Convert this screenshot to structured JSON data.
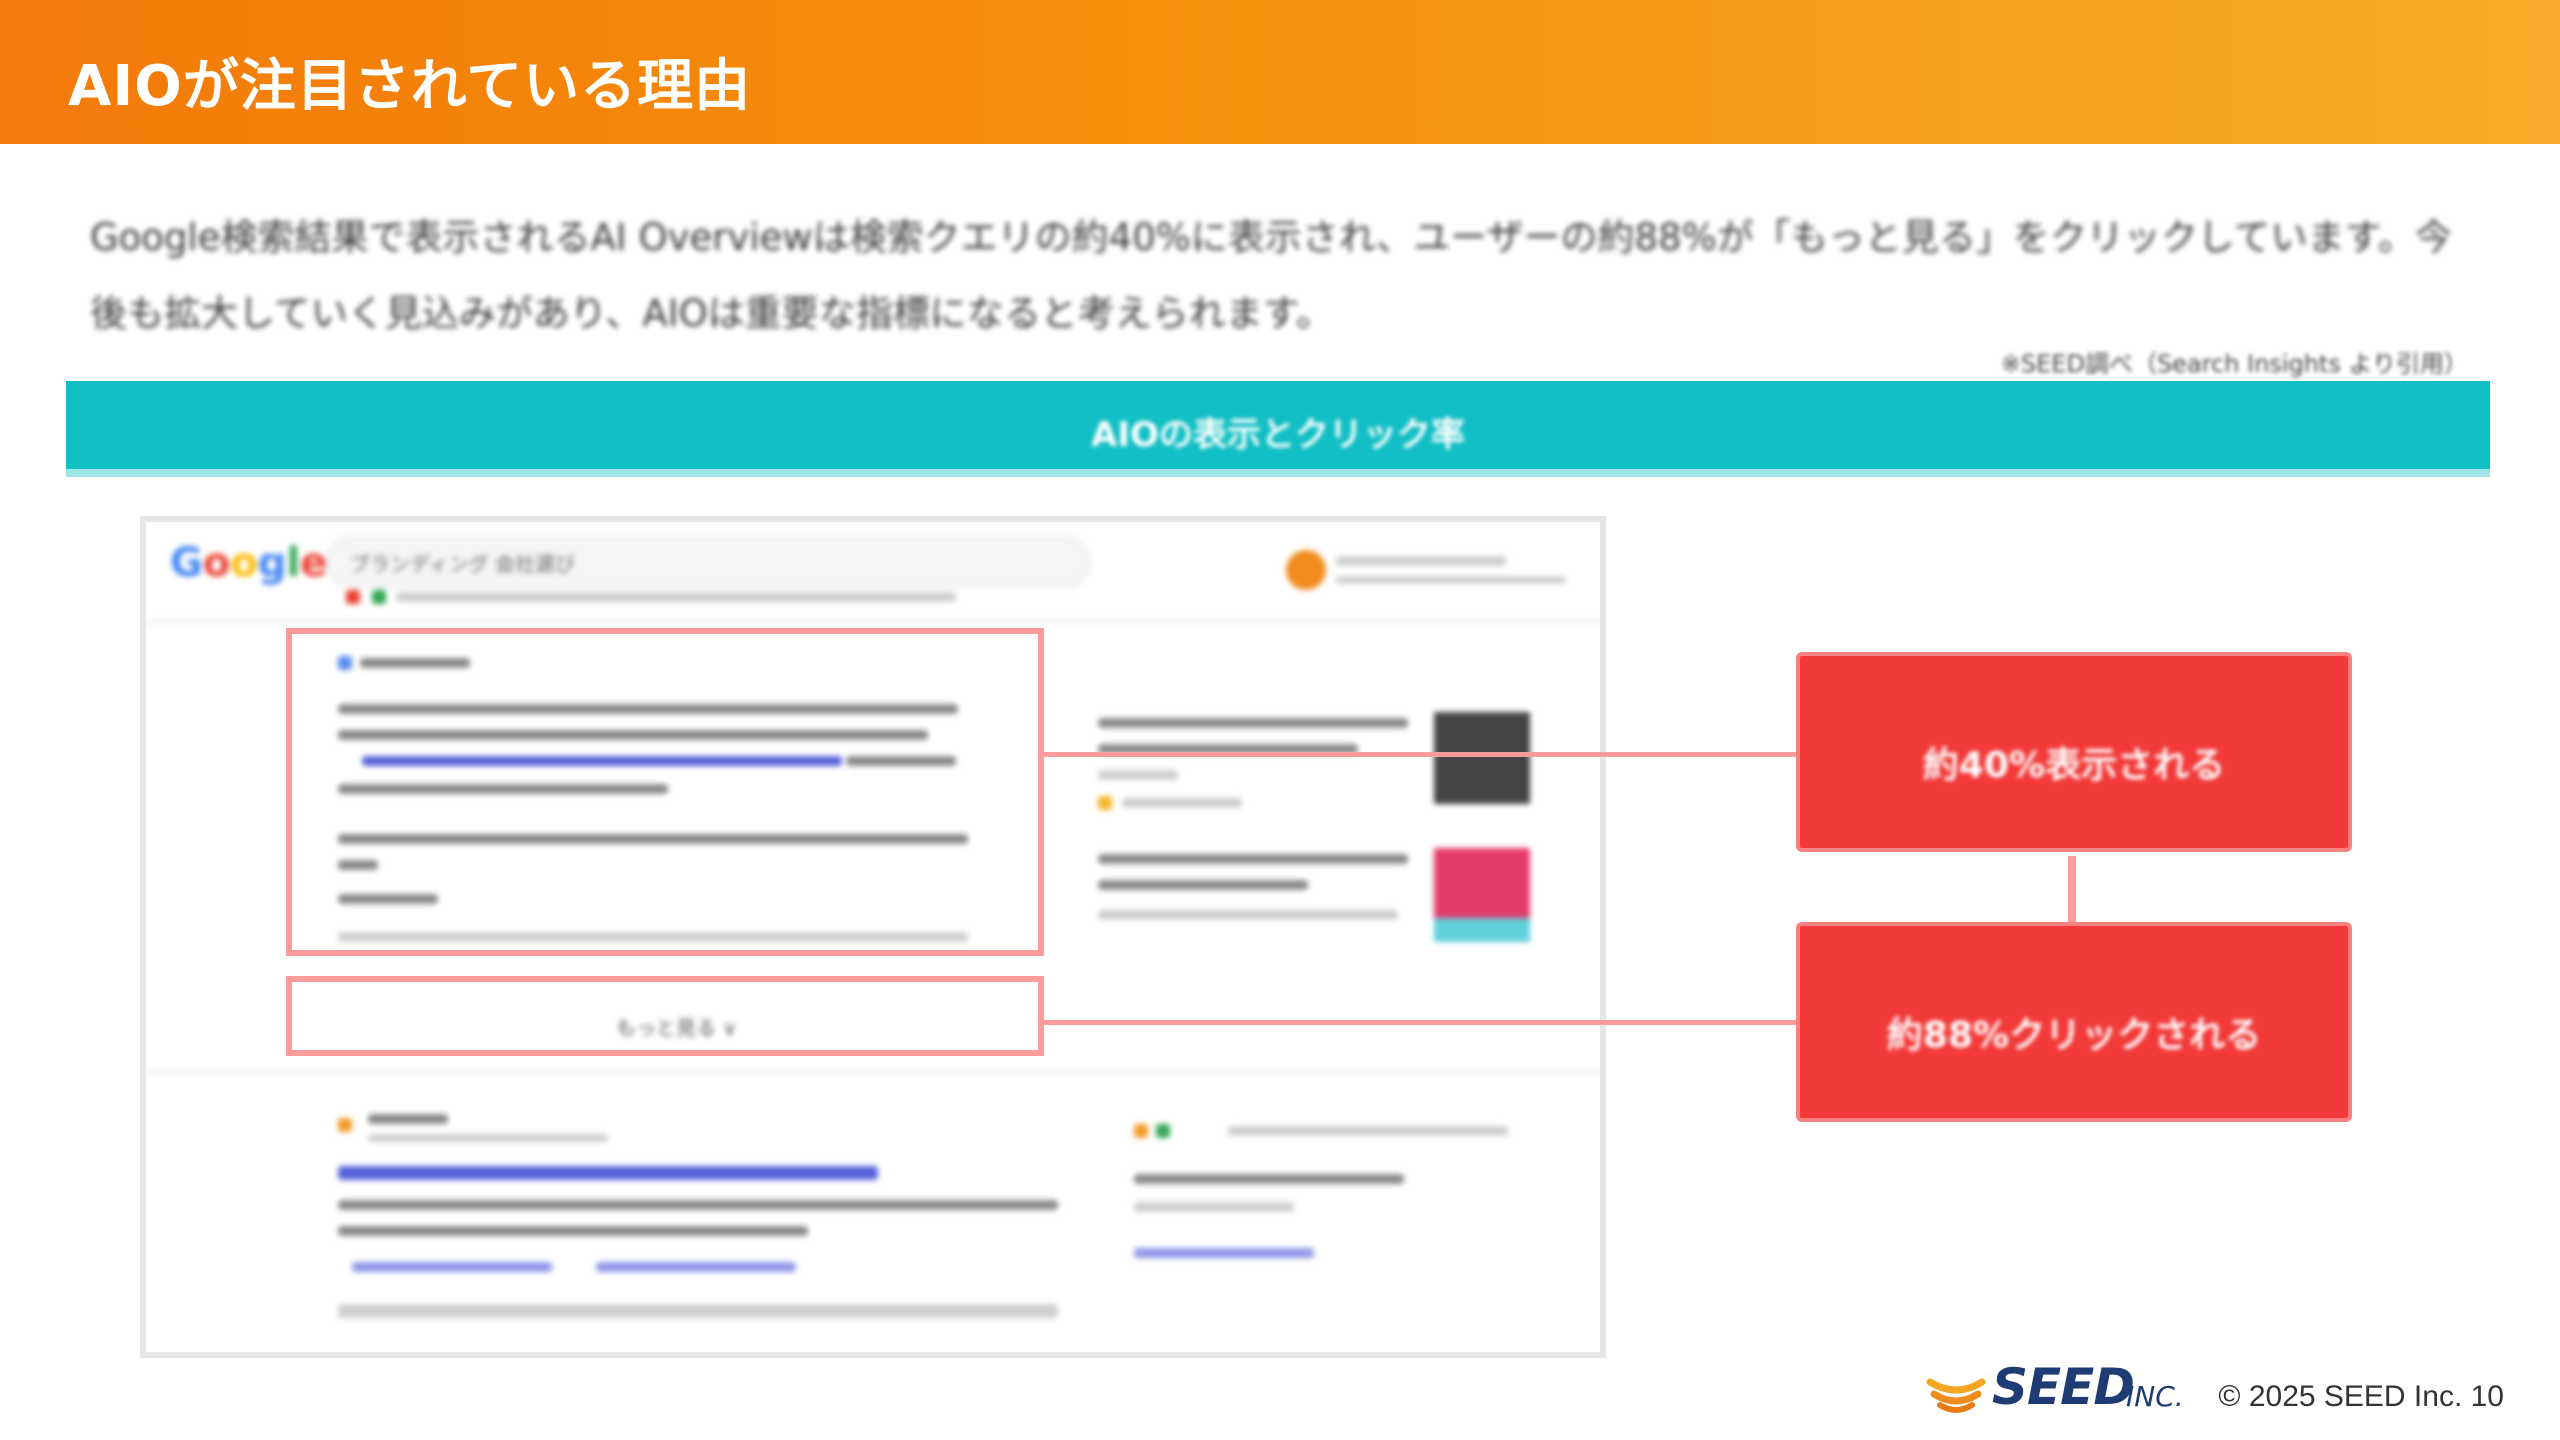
{
  "header": {
    "title": "AIOが注目されている理由"
  },
  "intro": {
    "text": "Google検索結果で表示されるAI Overviewは検索クエリの約40%に表示され、ユーザーの約88%が「もっと見る」をクリックしています。今後も拡大していく見込みがあり、AIOは重要な指標になると考えられます。"
  },
  "source_note": "※SEED調べ（Search Insights より引用）",
  "section_bar": {
    "label": "AIOの表示とクリック率"
  },
  "screenshot": {
    "logo_letters": [
      "G",
      "o",
      "o",
      "g",
      "l",
      "e"
    ],
    "query": "ブランディング 会社選び",
    "more_label": "もっと見る ∨"
  },
  "callouts": {
    "top": "約40%表示される",
    "bottom": "約88%クリックされる"
  },
  "footer": {
    "brand": "SEED",
    "brand_suffix": "INC.",
    "copyright": "© 2025 SEED Inc. 10"
  },
  "colors": {
    "header_start": "#f47a0a",
    "header_end": "#f8ab2a",
    "teal": "#12bfc4",
    "callout_red": "#f23a3a",
    "frame_pink": "#fb9b9b"
  }
}
